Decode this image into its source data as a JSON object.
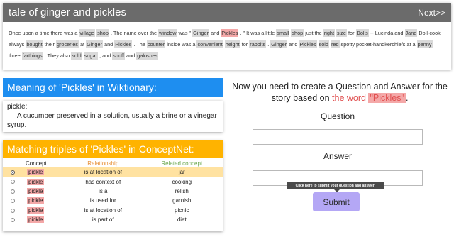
{
  "story": {
    "title": "tale of ginger and pickles",
    "next_label": "Next>>",
    "segments": [
      {
        "t": "Once upon a time there was a "
      },
      {
        "t": "village",
        "h": 1
      },
      {
        "t": " "
      },
      {
        "t": "shop",
        "h": 1
      },
      {
        "t": " . The name over the "
      },
      {
        "t": "window",
        "h": 1
      },
      {
        "t": " was \" "
      },
      {
        "t": "Ginger",
        "h": 1
      },
      {
        "t": " and "
      },
      {
        "t": "Pickles",
        "h": 2
      },
      {
        "t": " . \" It was a little "
      },
      {
        "t": "small",
        "h": 1
      },
      {
        "t": " "
      },
      {
        "t": "shop",
        "h": 1
      },
      {
        "t": " just the "
      },
      {
        "t": "right",
        "h": 1
      },
      {
        "t": " "
      },
      {
        "t": "size",
        "h": 1
      },
      {
        "t": " for "
      },
      {
        "t": "Dolls",
        "h": 1
      },
      {
        "t": " -- Lucinda and "
      },
      {
        "t": "Jane",
        "h": 1
      },
      {
        "t": " Doll-cook always "
      },
      {
        "t": "bought",
        "h": 1
      },
      {
        "t": " their "
      },
      {
        "t": "groceries",
        "h": 1
      },
      {
        "t": " at "
      },
      {
        "t": "Ginger",
        "h": 1
      },
      {
        "t": " and "
      },
      {
        "t": "Pickles",
        "h": 1
      },
      {
        "t": " . The "
      },
      {
        "t": "counter",
        "h": 1
      },
      {
        "t": " inside was a "
      },
      {
        "t": "convenient",
        "h": 1
      },
      {
        "t": " "
      },
      {
        "t": "height",
        "h": 1
      },
      {
        "t": " for "
      },
      {
        "t": "rabbits",
        "h": 1
      },
      {
        "t": " . "
      },
      {
        "t": "Ginger",
        "h": 1
      },
      {
        "t": " and "
      },
      {
        "t": "Pickles",
        "h": 1
      },
      {
        "t": " "
      },
      {
        "t": "sold",
        "h": 1
      },
      {
        "t": " "
      },
      {
        "t": "red",
        "h": 1
      },
      {
        "t": " spotty pocket-handkerchiefs at a "
      },
      {
        "t": "penny",
        "h": 1
      },
      {
        "t": " three "
      },
      {
        "t": "farthings",
        "h": 1
      },
      {
        "t": " . They also "
      },
      {
        "t": "sold",
        "h": 1
      },
      {
        "t": " "
      },
      {
        "t": "sugar",
        "h": 1
      },
      {
        "t": " , and "
      },
      {
        "t": "snuff",
        "h": 1
      },
      {
        "t": " and "
      },
      {
        "t": "galoshes",
        "h": 1
      },
      {
        "t": " ."
      }
    ]
  },
  "wiktionary": {
    "header": "Meaning of 'Pickles' in Wiktionary:",
    "term": "pickle:",
    "definition": "A cucumber preserved in a solution, usually a brine or a vinegar syrup."
  },
  "conceptnet": {
    "header": "Matching triples of 'Pickles' in ConceptNet:",
    "columns": {
      "concept": "Concept",
      "relationship": "Relationship",
      "related": "Related concept"
    },
    "rows": [
      {
        "concept": "pickle",
        "relationship": "is at location of",
        "related": "jar",
        "selected": true
      },
      {
        "concept": "pickle",
        "relationship": "has context of",
        "related": "cooking",
        "selected": false
      },
      {
        "concept": "pickle",
        "relationship": "is a",
        "related": "relish",
        "selected": false
      },
      {
        "concept": "pickle",
        "relationship": "is used for",
        "related": "garnish",
        "selected": false
      },
      {
        "concept": "pickle",
        "relationship": "is at location of",
        "related": "picnic",
        "selected": false
      },
      {
        "concept": "pickle",
        "relationship": "is part of",
        "related": "diet",
        "selected": false
      }
    ]
  },
  "task": {
    "prompt_line1": "Now you need to create a Question and Answer for the",
    "prompt_line2_pre": "story based on ",
    "prompt_word_label": "the word",
    "prompt_word": "\"Pickles\"",
    "prompt_end": "."
  },
  "form": {
    "question_label": "Question",
    "question_value": "",
    "answer_label": "Answer",
    "answer_value": "",
    "tooltip": "Click here to submit your question and answer!",
    "submit_label": "Submit"
  },
  "colors": {
    "story_header": "#6b6b6b",
    "wiktionary_header": "#1e8ef0",
    "conceptnet_header": "#ffb300",
    "highlight_target": "#f4a8a8",
    "highlight_word": "#d9d9d9",
    "submit_button": "#b4a7f5"
  }
}
